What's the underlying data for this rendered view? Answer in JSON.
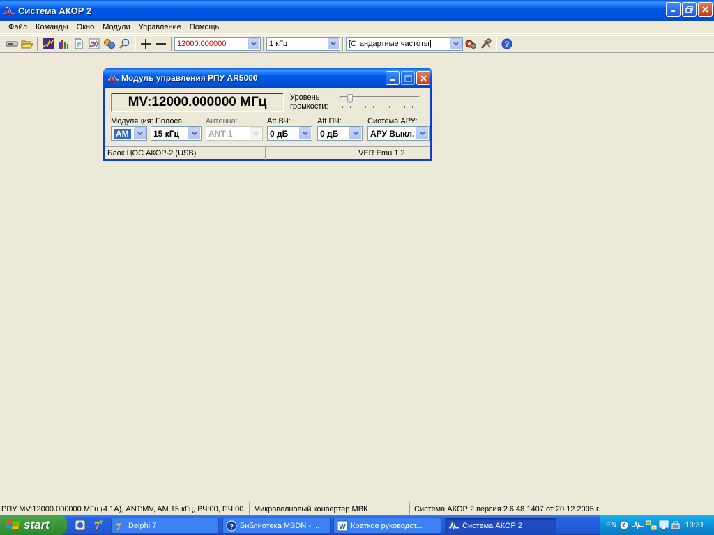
{
  "app": {
    "title": "Система АКОР 2"
  },
  "menu": [
    "Файл",
    "Команды",
    "Окно",
    "Модули",
    "Управление",
    "Помощь"
  ],
  "toolbar": {
    "frequency_value": "12000.000000",
    "step_value": "1 кГц",
    "freq_list_value": "[Стандартные частоты]",
    "frequency_color": "#C00000"
  },
  "child": {
    "title": "Модуль управления РПУ AR5000",
    "freq_display": "MV:12000.000000 МГц",
    "volume_label_1": "Уровень",
    "volume_label_2": "громкости:",
    "volume_level": 0.1,
    "fields": {
      "modulation": {
        "label": "Модуляция:",
        "value": "AM"
      },
      "band": {
        "label": "Полоса:",
        "value": "15 кГц"
      },
      "antenna": {
        "label": "Антенна:",
        "value": "ANT 1"
      },
      "att_rf": {
        "label": "Att ВЧ:",
        "value": "0 дБ"
      },
      "att_if": {
        "label": "Att ПЧ:",
        "value": "0 дБ"
      },
      "agc": {
        "label": "Система АРУ:",
        "value": "АРУ Выкл."
      }
    },
    "status": [
      "Блок ЦОС АКОР-2 (USB)",
      "",
      "",
      "VER Emu 1.2"
    ]
  },
  "statusbar": [
    "РПУ MV:12000.000000 МГц (4.1А), ANT:MV, AM 15 кГц, ВЧ:00, ПЧ:00",
    "Микроволновый конвертер МВК",
    "Система АКОР 2 версия 2.6.48.1407 от 20.12.2005 г."
  ],
  "taskbar": {
    "start_label": "start",
    "tasks": [
      "Delphi 7",
      "Библиотека MSDN - ...",
      "Краткое руководст...",
      "Система АКОР 2"
    ],
    "lang": "EN",
    "clock": "13:31"
  }
}
